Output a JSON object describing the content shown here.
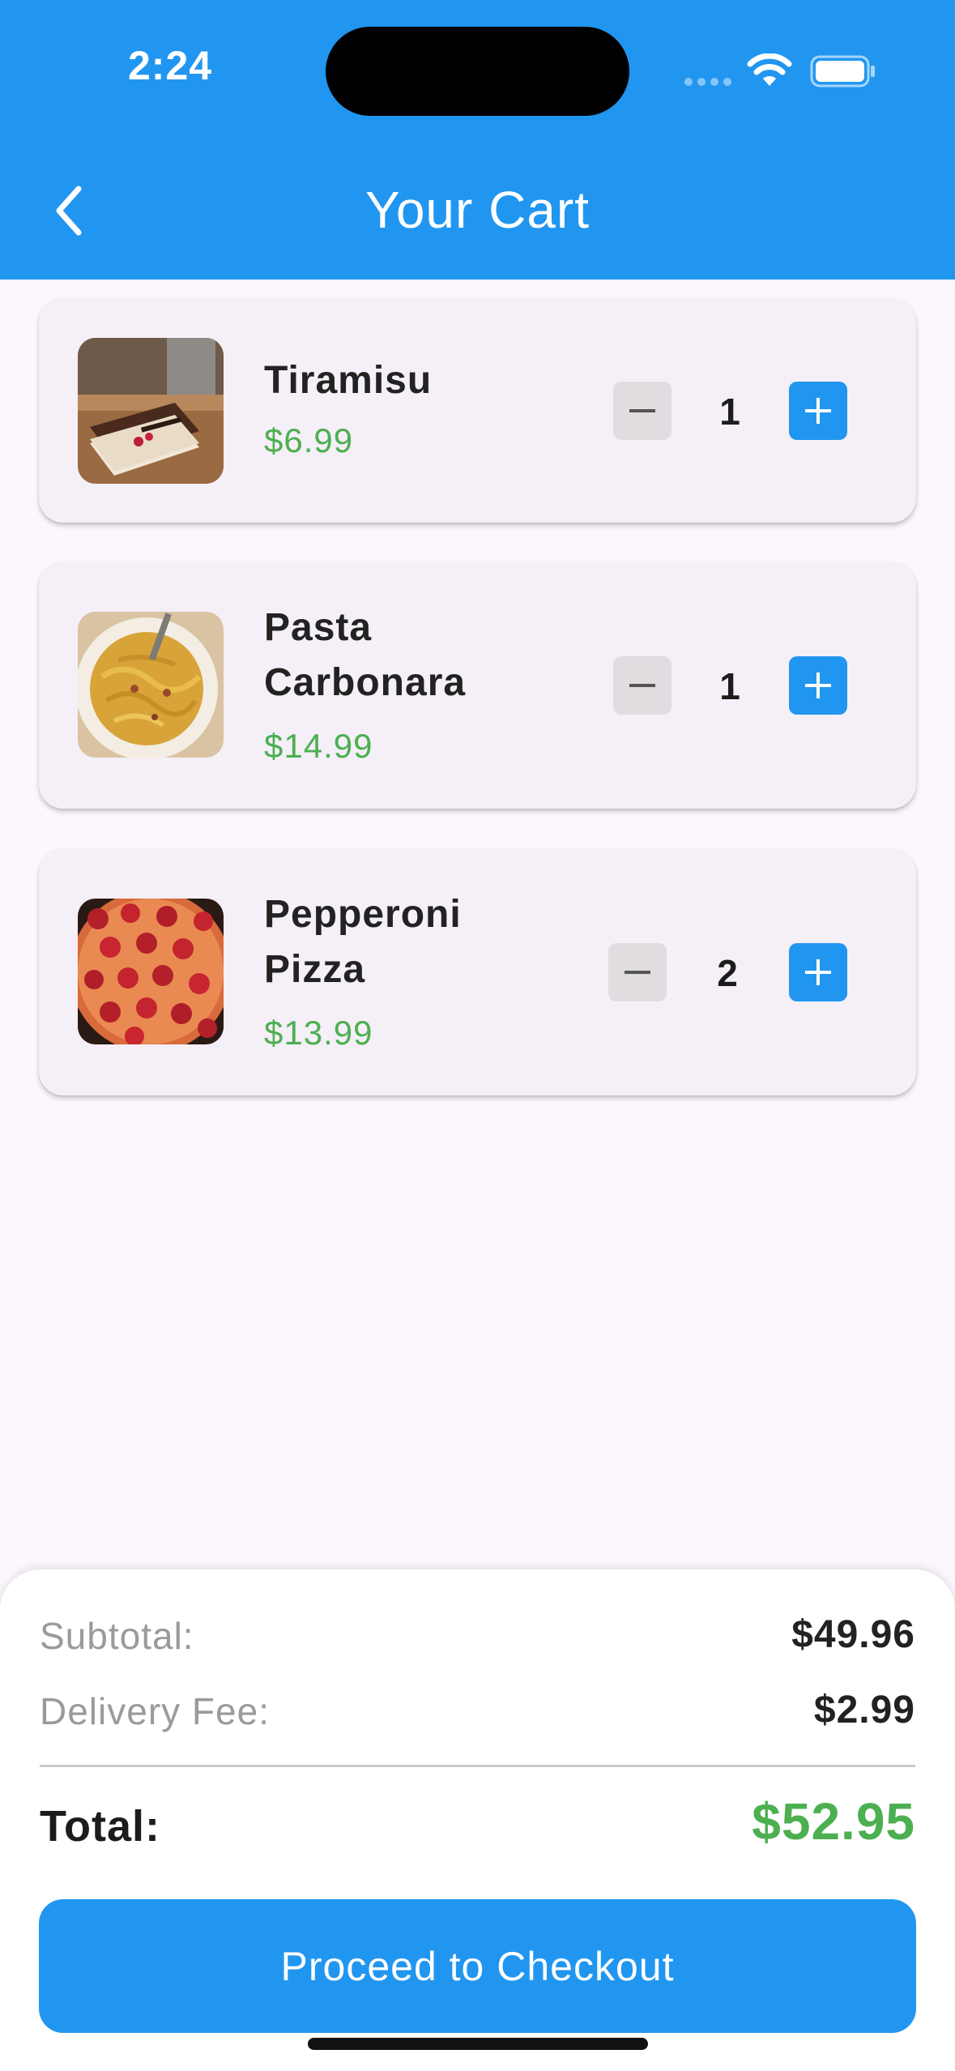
{
  "status_bar": {
    "time": "2:24"
  },
  "header": {
    "title": "Your Cart",
    "back_icon": "chevron-left-icon"
  },
  "cart": {
    "items": [
      {
        "name": "Tiramisu",
        "price": "$6.99",
        "quantity": "1"
      },
      {
        "name": "Pasta Carbonara",
        "price": "$14.99",
        "quantity": "1"
      },
      {
        "name": "Pepperoni Pizza",
        "price": "$13.99",
        "quantity": "2"
      }
    ]
  },
  "summary": {
    "subtotal_label": "Subtotal:",
    "subtotal_value": "$49.96",
    "delivery_label": "Delivery Fee:",
    "delivery_value": "$2.99",
    "total_label": "Total:",
    "total_value": "$52.95",
    "checkout_label": "Proceed to Checkout"
  },
  "colors": {
    "primary": "#2196f0",
    "price_green": "#4caf50",
    "background": "#fcf6fd",
    "card": "#f5eff7"
  }
}
